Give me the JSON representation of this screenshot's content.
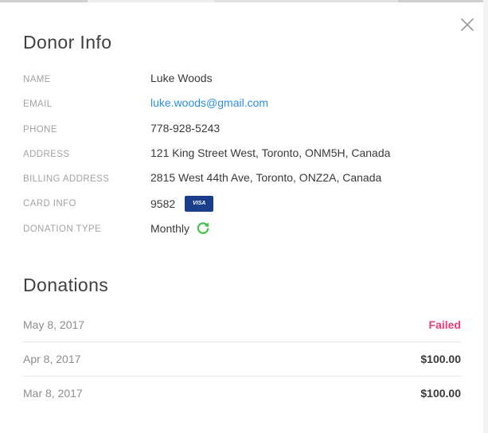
{
  "donor_info": {
    "title": "Donor Info",
    "fields": {
      "name": {
        "label": "NAME",
        "value": "Luke Woods"
      },
      "email": {
        "label": "EMAIL",
        "value": "luke.woods@gmail.com"
      },
      "phone": {
        "label": "PHONE",
        "value": "778-928-5243"
      },
      "address": {
        "label": "ADDRESS",
        "value": "121 King Street West, Toronto, ONM5H, Canada"
      },
      "billing": {
        "label": "BILLING ADDRESS",
        "value": "2815 West 44th Ave, Toronto, ONZ2A, Canada"
      },
      "card": {
        "label": "CARD INFO",
        "value": "9582",
        "brand": "VISA"
      },
      "donation_type": {
        "label": "DONATION TYPE",
        "value": "Monthly",
        "icon": "refresh-icon"
      }
    }
  },
  "donations": {
    "title": "Donations",
    "rows": [
      {
        "date": "May 8, 2017",
        "amount": "Failed",
        "status": "failed"
      },
      {
        "date": "Apr 8, 2017",
        "amount": "$100.00",
        "status": "ok"
      },
      {
        "date": "Mar 8, 2017",
        "amount": "$100.00",
        "status": "ok"
      }
    ]
  },
  "colors": {
    "link": "#2f8ee0",
    "failed": "#ea3d78",
    "refresh_icon": "#44c24a",
    "visa_badge": "#1a3e8c"
  },
  "icons": {
    "close": "close-icon",
    "card_brand": "visa-badge",
    "recurring": "refresh-icon"
  }
}
